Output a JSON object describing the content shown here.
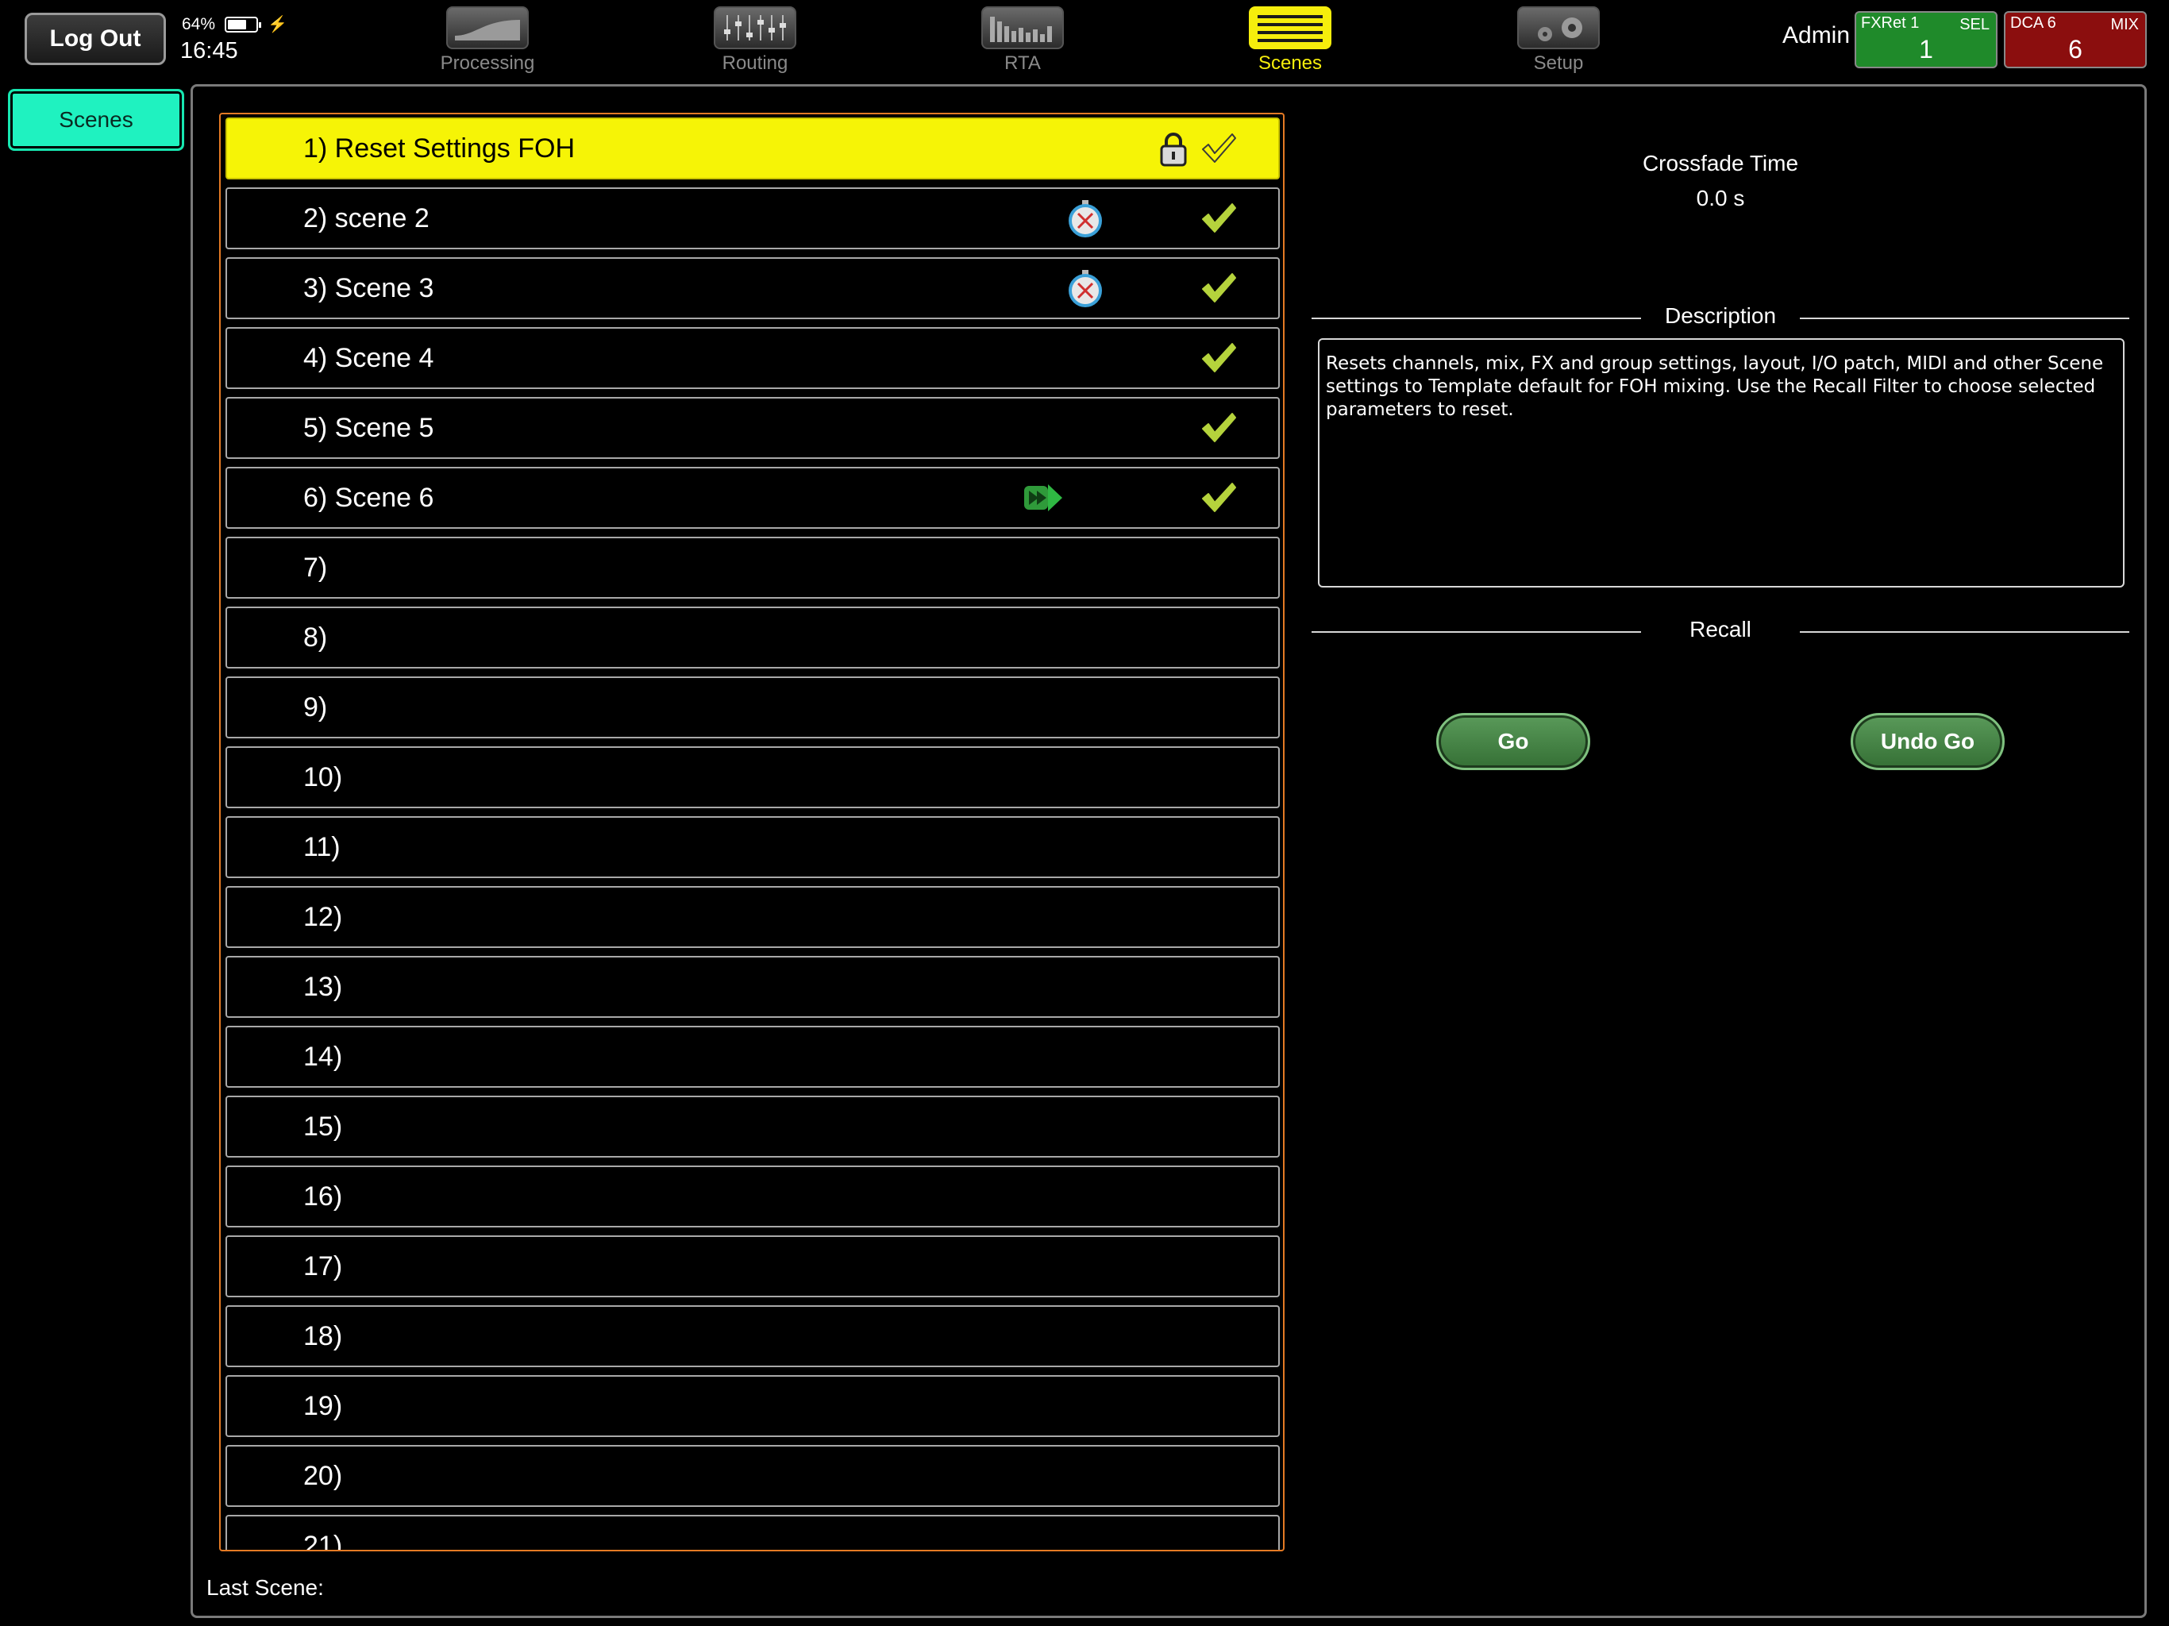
{
  "top_bar": {
    "logout_label": "Log Out",
    "battery_percent": "64%",
    "clock": "16:45",
    "tabs": [
      {
        "label": "Processing",
        "icon": "processing-curve-icon",
        "active": false
      },
      {
        "label": "Routing",
        "icon": "routing-faders-icon",
        "active": false
      },
      {
        "label": "RTA",
        "icon": "rta-bars-icon",
        "active": false
      },
      {
        "label": "Scenes",
        "icon": "scenes-list-icon",
        "active": true
      },
      {
        "label": "Setup",
        "icon": "setup-gears-icon",
        "active": false
      }
    ],
    "user": "Admin",
    "status_boxes": [
      {
        "name": "FXRet 1",
        "tag": "SEL",
        "value": "1",
        "color": "#1f8a2a"
      },
      {
        "name": "DCA 6",
        "tag": "MIX",
        "value": "6",
        "color": "#8b0e0e"
      }
    ]
  },
  "sidebar": {
    "scenes_label": "Scenes",
    "accent": "#1ff2c0"
  },
  "scenes": [
    {
      "label": "1) Reset Settings FOH",
      "selected": true,
      "lock": true,
      "check": true,
      "badge": ""
    },
    {
      "label": "2) scene 2",
      "selected": false,
      "lock": false,
      "check": true,
      "badge": "timer"
    },
    {
      "label": "3) Scene 3",
      "selected": false,
      "lock": false,
      "check": true,
      "badge": "timer"
    },
    {
      "label": "4) Scene 4",
      "selected": false,
      "lock": false,
      "check": true,
      "badge": ""
    },
    {
      "label": "5) Scene 5",
      "selected": false,
      "lock": false,
      "check": true,
      "badge": ""
    },
    {
      "label": "6) Scene 6",
      "selected": false,
      "lock": false,
      "check": true,
      "badge": "play"
    },
    {
      "label": "7)",
      "selected": false,
      "lock": false,
      "check": false,
      "badge": ""
    },
    {
      "label": "8)",
      "selected": false,
      "lock": false,
      "check": false,
      "badge": ""
    },
    {
      "label": "9)",
      "selected": false,
      "lock": false,
      "check": false,
      "badge": ""
    },
    {
      "label": "10)",
      "selected": false,
      "lock": false,
      "check": false,
      "badge": ""
    },
    {
      "label": "11)",
      "selected": false,
      "lock": false,
      "check": false,
      "badge": ""
    },
    {
      "label": "12)",
      "selected": false,
      "lock": false,
      "check": false,
      "badge": ""
    },
    {
      "label": "13)",
      "selected": false,
      "lock": false,
      "check": false,
      "badge": ""
    },
    {
      "label": "14)",
      "selected": false,
      "lock": false,
      "check": false,
      "badge": ""
    },
    {
      "label": "15)",
      "selected": false,
      "lock": false,
      "check": false,
      "badge": ""
    },
    {
      "label": "16)",
      "selected": false,
      "lock": false,
      "check": false,
      "badge": ""
    },
    {
      "label": "17)",
      "selected": false,
      "lock": false,
      "check": false,
      "badge": ""
    },
    {
      "label": "18)",
      "selected": false,
      "lock": false,
      "check": false,
      "badge": ""
    },
    {
      "label": "19)",
      "selected": false,
      "lock": false,
      "check": false,
      "badge": ""
    },
    {
      "label": "20)",
      "selected": false,
      "lock": false,
      "check": false,
      "badge": ""
    },
    {
      "label": "21)",
      "selected": false,
      "lock": false,
      "check": false,
      "badge": ""
    }
  ],
  "last_scene_label": "Last Scene:",
  "details": {
    "crossfade_title": "Crossfade Time",
    "crossfade_value": "0.0 s",
    "description_title": "Description",
    "description_text": "Resets channels, mix, FX and group settings, layout, I/O patch, MIDI and other Scene settings to Template default for FOH mixing.  Use the Recall Filter to choose selected parameters to reset.",
    "recall_title": "Recall",
    "go_label": "Go",
    "undo_go_label": "Undo Go"
  },
  "colors": {
    "selected_row": "#f6f406",
    "list_border": "#e47a24",
    "check": "#b5d33c",
    "active_tab": "#f6ee0c"
  }
}
